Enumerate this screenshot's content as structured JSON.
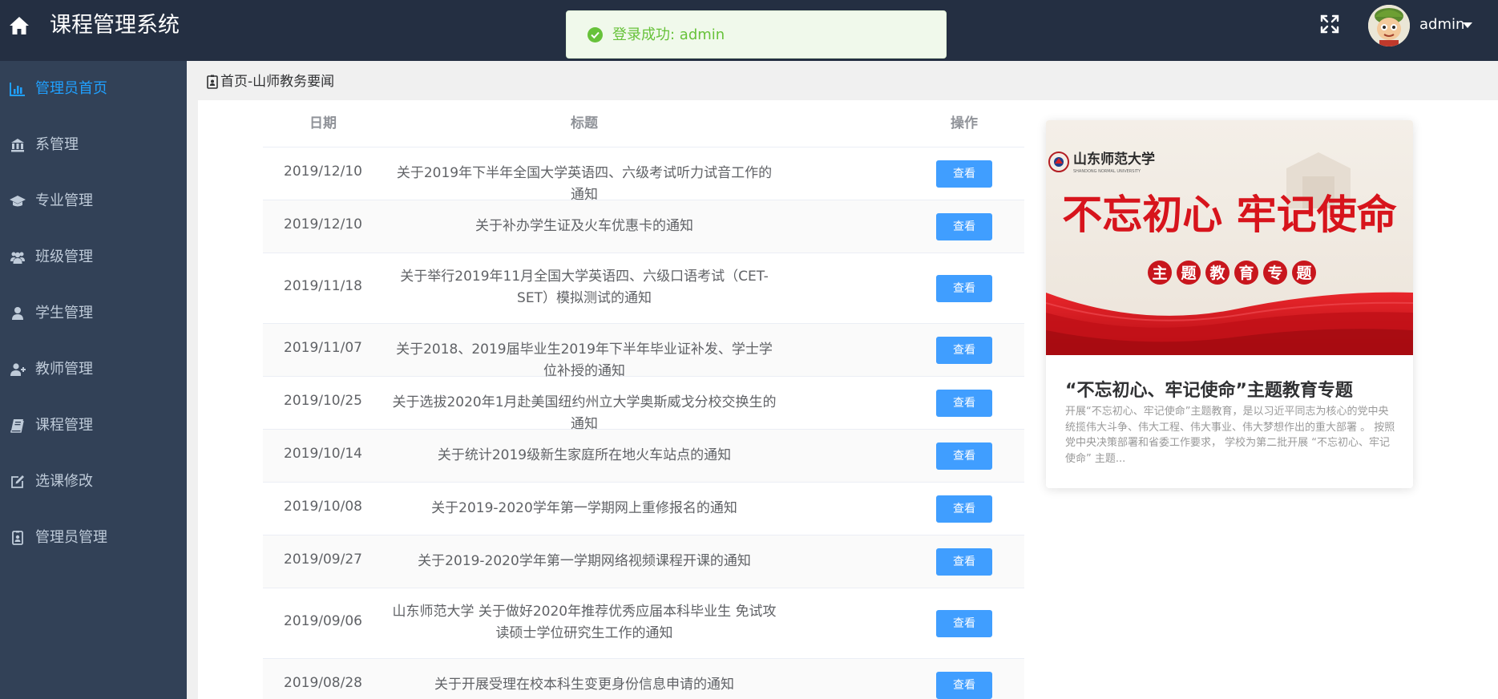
{
  "header": {
    "title": "课程管理系统",
    "user_name": "admin",
    "icons": {
      "home": "home-icon",
      "fullscreen": "fullscreen-icon",
      "dropdown": "caret-down-icon"
    }
  },
  "toast": {
    "message": "登录成功: admin",
    "type": "success",
    "color": "#67c23a"
  },
  "sidebar": {
    "items": [
      {
        "label": "管理员首页",
        "icon": "bar-chart-icon",
        "active": true
      },
      {
        "label": "系管理",
        "icon": "building-icon",
        "active": false
      },
      {
        "label": "专业管理",
        "icon": "graduation-cap-icon",
        "active": false
      },
      {
        "label": "班级管理",
        "icon": "users-icon",
        "active": false
      },
      {
        "label": "学生管理",
        "icon": "user-icon",
        "active": false
      },
      {
        "label": "教师管理",
        "icon": "user-plus-icon",
        "active": false
      },
      {
        "label": "课程管理",
        "icon": "book-icon",
        "active": false
      },
      {
        "label": "选课修改",
        "icon": "edit-icon",
        "active": false
      },
      {
        "label": "管理员管理",
        "icon": "id-badge-icon",
        "active": false
      }
    ]
  },
  "breadcrumb": {
    "text": "首页-山师教务要闻"
  },
  "table": {
    "columns": [
      "日期",
      "标题",
      "操作"
    ],
    "button_label": "查看",
    "rows": [
      {
        "date": "2019/12/10",
        "title": "关于2019年下半年全国大学英语四、六级考试听力试音工作的通知"
      },
      {
        "date": "2019/12/10",
        "title": "关于补办学生证及火车优惠卡的通知"
      },
      {
        "date": "2019/11/18",
        "title": "关于举行2019年11月全国大学英语四、六级口语考试（CET-SET）模拟测试的通知"
      },
      {
        "date": "2019/11/07",
        "title": "关于2018、2019届毕业生2019年下半年毕业证补发、学士学位补授的通知"
      },
      {
        "date": "2019/10/25",
        "title": "关于选拔2020年1月赴美国纽约州立大学奥斯威戈分校交换生的通知"
      },
      {
        "date": "2019/10/14",
        "title": "关于统计2019级新生家庭所在地火车站点的通知"
      },
      {
        "date": "2019/10/08",
        "title": "关于2019-2020学年第一学期网上重修报名的通知"
      },
      {
        "date": "2019/09/27",
        "title": "关于2019-2020学年第一学期网络视频课程开课的通知"
      },
      {
        "date": "2019/09/06",
        "title": "山东师范大学 关于做好2020年推荐优秀应届本科毕业生 免试攻读硕士学位研究生工作的通知"
      },
      {
        "date": "2019/08/28",
        "title": "关于开展受理在校本科生变更身份信息申请的通知"
      }
    ]
  },
  "feature": {
    "banner_headline": "不忘初心 牢记使命",
    "banner_subtitle": "主题教育专题",
    "banner_school": "山东师范大学",
    "banner_school_en": "SHANDONG NORMAL UNIVERSITY",
    "title": "“不忘初心、牢记使命”主题教育专题",
    "description": "开展“不忘初心、牢记使命”主题教育，是以习近平同志为核心的党中央统揽伟大斗争、伟大工程、伟大事业、伟大梦想作出的重大部署 。 按照党中央决策部署和省委工作要求， 学校为第二批开展 “不忘初心、牢记使命” 主题..."
  },
  "colors": {
    "header_bg": "#242f42",
    "sidebar_bg": "#324157",
    "sidebar_text": "#bfcbd9",
    "sidebar_active": "#20a0ff",
    "button": "#409eff",
    "banner_red": "#d7141c"
  }
}
